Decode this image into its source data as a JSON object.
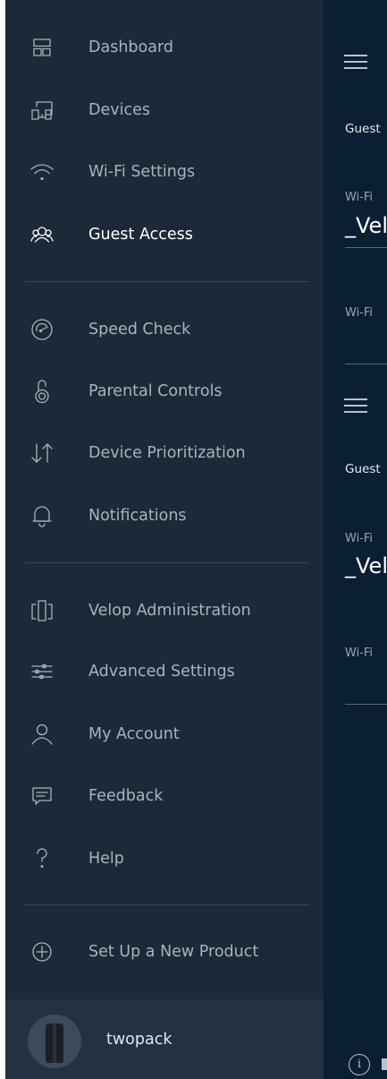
{
  "menu": {
    "group1": [
      {
        "id": "dashboard",
        "label": "Dashboard",
        "icon": "dashboard-icon"
      },
      {
        "id": "devices",
        "label": "Devices",
        "icon": "devices-icon"
      },
      {
        "id": "wifi-settings",
        "label": "Wi-Fi Settings",
        "icon": "wifi-icon"
      },
      {
        "id": "guest-access",
        "label": "Guest Access",
        "icon": "guest-access-icon",
        "active": true
      }
    ],
    "group2": [
      {
        "id": "speed-check",
        "label": "Speed Check",
        "icon": "speedometer-icon"
      },
      {
        "id": "parental-controls",
        "label": "Parental Controls",
        "icon": "padlock-icon"
      },
      {
        "id": "device-prioritization",
        "label": "Device Prioritization",
        "icon": "priority-arrows-icon"
      },
      {
        "id": "notifications",
        "label": "Notifications",
        "icon": "bell-icon"
      }
    ],
    "group3": [
      {
        "id": "velop-administration",
        "label": "Velop Administration",
        "icon": "velop-nodes-icon"
      },
      {
        "id": "advanced-settings",
        "label": "Advanced Settings",
        "icon": "sliders-icon"
      },
      {
        "id": "my-account",
        "label": "My Account",
        "icon": "user-icon"
      },
      {
        "id": "feedback",
        "label": "Feedback",
        "icon": "chat-bubble-icon"
      },
      {
        "id": "help",
        "label": "Help",
        "icon": "question-icon"
      }
    ],
    "group4": [
      {
        "id": "set-up-new-product",
        "label": "Set Up a New Product",
        "icon": "plus-circle-icon"
      }
    ]
  },
  "footer": {
    "username": "twopack",
    "avatar_icon": "velop-node-avatar"
  },
  "behind": {
    "guest_label": "Guest",
    "wifi_label": "Wi-Fi",
    "network_value": "_Vel",
    "network_value_2": "_Vel",
    "info_icon": "info-icon",
    "info_glyph": "i"
  },
  "colors": {
    "drawer_bg": "#1d2838",
    "panel_bg": "#0a1f33",
    "text": "#a9b3bf",
    "active_text": "#ffffff"
  }
}
